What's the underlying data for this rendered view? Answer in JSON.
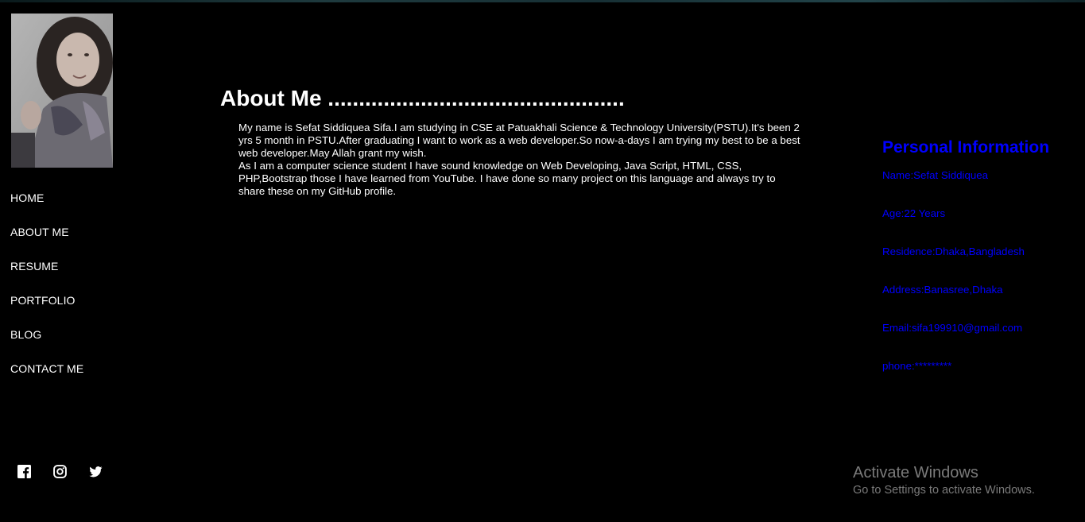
{
  "nav": {
    "items": [
      {
        "label": "HOME"
      },
      {
        "label": "ABOUT ME"
      },
      {
        "label": "RESUME"
      },
      {
        "label": "PORTFOLIO"
      },
      {
        "label": "BLOG"
      },
      {
        "label": "CONTACT ME"
      }
    ]
  },
  "social": {
    "icons": [
      "facebook-icon",
      "instagram-icon",
      "twitter-icon"
    ]
  },
  "about": {
    "title": "About Me ................................................",
    "paragraph1": "My name is Sefat Siddiquea Sifa.I am studying in CSE at Patuakhali Science & Technology University(PSTU).It's been 2 yrs 5 month in PSTU.After graduating I want to work as a web developer.So now-a-days I am trying my best to be a best web developer.May Allah grant my wish.",
    "paragraph2": "As I am a computer science student I have sound knowledge on Web Developing, Java Script, HTML, CSS, PHP,Bootstrap those I have learned from YouTube. I have done so many project on this language and always try to share these on my GitHub profile."
  },
  "personal_info": {
    "heading": "Personal Information",
    "items": [
      {
        "text": "Name:Sefat Siddiquea"
      },
      {
        "text": "Age:22 Years"
      },
      {
        "text": "Residence:Dhaka,Bangladesh"
      },
      {
        "text": "Address:Banasree,Dhaka"
      },
      {
        "text": "Email:sifa199910@gmail.com"
      },
      {
        "text": "phone:*********"
      }
    ]
  },
  "watermark": {
    "title": "Activate Windows",
    "subtitle": "Go to Settings to activate Windows."
  },
  "colors": {
    "background": "#000000",
    "text": "#ffffff",
    "info_accent": "#0000ff"
  }
}
